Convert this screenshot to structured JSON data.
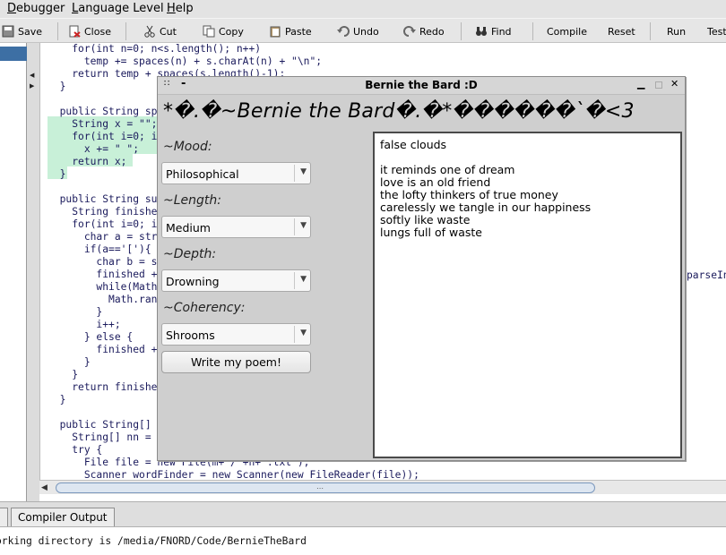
{
  "menubar": {
    "items": [
      {
        "text": "Debugger",
        "underline": "D",
        "rest": "ebugger"
      },
      {
        "text": "Language Level",
        "underline": "L",
        "rest": "anguage Level"
      },
      {
        "text": "Help",
        "underline": "H",
        "rest": "elp"
      }
    ]
  },
  "toolbar": {
    "save_label": "Save",
    "close_label": "Close",
    "cut_label": "Cut",
    "copy_label": "Copy",
    "paste_label": "Paste",
    "undo_label": "Undo",
    "redo_label": "Redo",
    "find_label": "Find",
    "compile_label": "Compile",
    "reset_label": "Reset",
    "run_label": "Run",
    "test_label": "Test"
  },
  "editor": {
    "lines": [
      {
        "indent": "    ",
        "text": "for(int n=0; n<s.length(); n++)"
      },
      {
        "indent": "      ",
        "text": "temp += spaces(n) + s.charAt(n) + \"\\n\";"
      },
      {
        "indent": "    ",
        "text": "return temp + spaces(s.length()-1);"
      },
      {
        "indent": "  ",
        "text": "}"
      },
      {
        "indent": "",
        "text": ""
      },
      {
        "indent": "  ",
        "text": "public String sp"
      },
      {
        "indent": "    ",
        "text": "String x = \"\";"
      },
      {
        "indent": "    ",
        "text": "for(int i=0; i"
      },
      {
        "indent": "      ",
        "text": "x += \" \";"
      },
      {
        "indent": "    ",
        "text": "return x;"
      },
      {
        "indent": "  ",
        "text": "}"
      },
      {
        "indent": "",
        "text": ""
      },
      {
        "indent": "  ",
        "text": "public String su"
      },
      {
        "indent": "    ",
        "text": "String finishe"
      },
      {
        "indent": "    ",
        "text": "for(int i=0; i"
      },
      {
        "indent": "      ",
        "text": "char a = str"
      },
      {
        "indent": "      ",
        "text": "if(a=='['){"
      },
      {
        "indent": "        ",
        "text": "char b = s"
      },
      {
        "indent": "        ",
        "text": "finished +"
      },
      {
        "indent": "        ",
        "text": "while(Math"
      },
      {
        "indent": "          ",
        "text": "Math.ran"
      },
      {
        "indent": "        ",
        "text": "}"
      },
      {
        "indent": "        ",
        "text": "i++;"
      },
      {
        "indent": "      ",
        "text": "} else {"
      },
      {
        "indent": "        ",
        "text": "finished +"
      },
      {
        "indent": "      ",
        "text": "}"
      },
      {
        "indent": "    ",
        "text": "}"
      },
      {
        "indent": "    ",
        "text": "return finishe"
      },
      {
        "indent": "  ",
        "text": "}"
      },
      {
        "indent": "",
        "text": ""
      },
      {
        "indent": "  ",
        "text": "public String[]"
      },
      {
        "indent": "    ",
        "text": "String[] nn ="
      },
      {
        "indent": "    ",
        "text": "try {"
      },
      {
        "indent": "      ",
        "text": "File file = new File(m+\"/\"+n+\".txt\");"
      },
      {
        "indent": "      ",
        "text": "Scanner wordFinder = new Scanner(new FileReader(file));"
      }
    ],
    "right_text": "parseIn"
  },
  "bottom": {
    "tab_compiler": "Compiler Output",
    "output_text": "orking directory is /media/FNORD/Code/BernieTheBard"
  },
  "dialog": {
    "title": "Bernie the Bard :D",
    "header": "*�.�~Bernie the Bard�.�*������`�<3",
    "mood_label": "~Mood:",
    "mood_value": "Philosophical",
    "length_label": "~Length:",
    "length_value": "Medium",
    "depth_label": "~Depth:",
    "depth_value": "Drowning",
    "coherency_label": "~Coherency:",
    "coherency_value": "Shrooms",
    "write_button": "Write my poem!",
    "poem": [
      "false clouds",
      "",
      "it reminds one of dream",
      "love is an old friend",
      "the lofty thinkers of true money",
      "carelessly we tangle in our happiness",
      "softly like waste",
      "lungs full of waste"
    ]
  },
  "colors": {
    "accent": "#3d6fa4",
    "highlight": "#c8f0d8",
    "keyword": "#2a3b96",
    "string": "#c03b2b"
  }
}
